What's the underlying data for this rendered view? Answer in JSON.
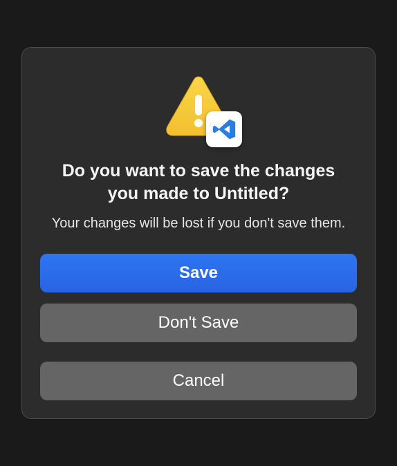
{
  "dialog": {
    "title": "Do you want to save the changes you made to Untitled?",
    "message": "Your changes will be lost if you don't save them.",
    "buttons": {
      "primary": "Save",
      "secondary": "Don't Save",
      "cancel": "Cancel"
    },
    "app_name": "Visual Studio Code",
    "colors": {
      "primary_button": "#2864e2",
      "secondary_button": "#656566",
      "dialog_bg": "#2c2c2d"
    }
  }
}
